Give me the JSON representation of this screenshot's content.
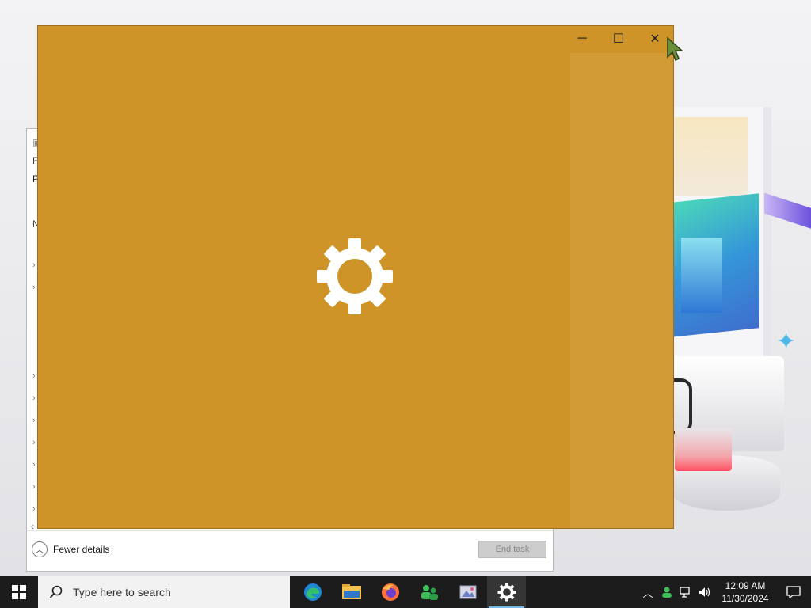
{
  "desktop": {
    "wallpaper_colors": {
      "accent_blue": "#4cb8ea",
      "lock_red": "#ff5260"
    }
  },
  "task_manager": {
    "footer": {
      "fewer_details_label": "Fewer details",
      "end_task_label": "End task"
    },
    "partial_labels": [
      "F",
      "P",
      "N"
    ]
  },
  "app_window": {
    "background_color": "#cf9428",
    "state": "loading",
    "center_icon": "gear-icon",
    "caption": {
      "minimize": "─",
      "maximize": "☐",
      "close": "✕"
    }
  },
  "taskbar": {
    "search_placeholder": "Type here to search",
    "pinned_apps": [
      {
        "name": "edge-icon"
      },
      {
        "name": "file-explorer-icon"
      },
      {
        "name": "firefox-icon"
      },
      {
        "name": "people-app-icon"
      },
      {
        "name": "photos-app-icon"
      },
      {
        "name": "settings-app-icon",
        "active": true
      }
    ],
    "clock": {
      "time": "12:09 AM",
      "date": "11/30/2024"
    }
  }
}
